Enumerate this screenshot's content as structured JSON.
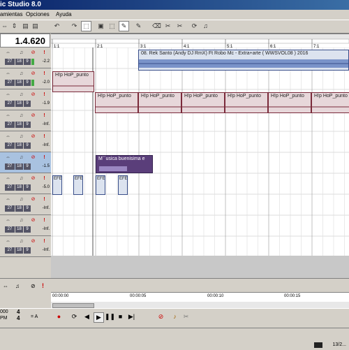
{
  "window": {
    "title_fragment": "ic Studio 8.0"
  },
  "menu": {
    "items": [
      "amientas",
      "Opciones",
      "Ayuda"
    ]
  },
  "position": {
    "readout": "1.4.620"
  },
  "ruler": {
    "labels": [
      "1:1",
      "2:1",
      "3:1",
      "4:1",
      "5:1",
      "6:1",
      "7:1"
    ]
  },
  "tracks": [
    {
      "a": "27",
      "b": "18",
      "c": "9",
      "vol": "-2.2",
      "meter": true,
      "selected": false
    },
    {
      "a": "27",
      "b": "18",
      "c": "9",
      "vol": "-2.0",
      "meter": true,
      "selected": false
    },
    {
      "a": "27",
      "b": "18",
      "c": "9",
      "vol": "-1.9",
      "meter": false,
      "selected": false
    },
    {
      "a": "27",
      "b": "18",
      "c": "9",
      "vol": "-Inf.",
      "meter": false,
      "selected": false
    },
    {
      "a": "27",
      "b": "18",
      "c": "9",
      "vol": "-Inf.",
      "meter": false,
      "selected": false
    },
    {
      "a": "27",
      "b": "18",
      "c": "9",
      "vol": "-1.5",
      "meter": false,
      "selected": true
    },
    {
      "a": "27",
      "b": "18",
      "c": "9",
      "vol": "-5.0",
      "meter": false,
      "selected": false
    },
    {
      "a": "27",
      "b": "18",
      "c": "9",
      "vol": "-Inf.",
      "meter": false,
      "selected": false
    },
    {
      "a": "27",
      "b": "18",
      "c": "9",
      "vol": "-Inf.",
      "meter": false,
      "selected": false
    },
    {
      "a": "27",
      "b": "18",
      "c": "9",
      "vol": "-Inf.",
      "meter": false,
      "selected": false
    }
  ],
  "clips": {
    "song": "08. Rek Santo (Andy DJ RmX) Ft Robo Mc - Extra+arte ( WWSVOL08 ) 2016",
    "hiphop": "H!p HoP_punto",
    "musica": "M`´usica buenisima e",
    "efe": "EFE"
  },
  "timeline": {
    "labels": [
      "00:00:00",
      "00:00:05",
      "00:00:10",
      "00:00:15"
    ]
  },
  "transport": {
    "tempo": "000",
    "tempo_unit": "PM",
    "sig_top": "4",
    "sig_bottom": "4",
    "mode": "= A"
  },
  "status": {
    "text": "13/2..."
  },
  "colors": {
    "accent": "#0a246a",
    "clip_red": "#7a2a3a",
    "clip_blue": "#3a4f8a",
    "clip_purple": "#5a3e7a",
    "meter": "#44aa44"
  }
}
